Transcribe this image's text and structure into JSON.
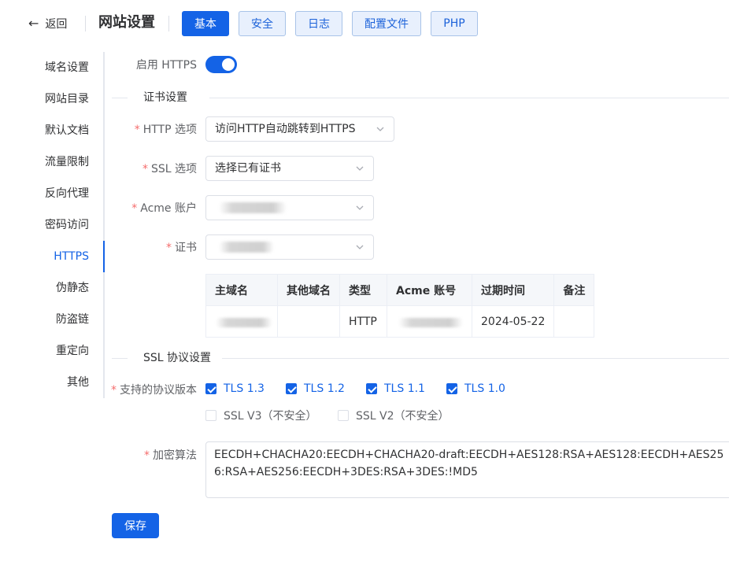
{
  "header": {
    "back_label": "返回",
    "title": "网站设置",
    "tabs": [
      "基本",
      "安全",
      "日志",
      "配置文件",
      "PHP"
    ]
  },
  "menu": {
    "items": [
      "域名设置",
      "网站目录",
      "默认文档",
      "流量限制",
      "反向代理",
      "密码访问",
      "HTTPS",
      "伪静态",
      "防盗链",
      "重定向",
      "其他"
    ],
    "active": "HTTPS"
  },
  "form": {
    "https_label": "启用 HTTPS",
    "https_enabled": true,
    "cert_section": "证书设置",
    "http_option_label": "HTTP 选项",
    "http_option_value": "访问HTTP自动跳转到HTTPS",
    "ssl_option_label": "SSL 选项",
    "ssl_option_value": "选择已有证书",
    "acme_label": "Acme 账户",
    "cert_label": "证书",
    "ssl_section": "SSL 协议设置",
    "protocols_label": "支持的协议版本",
    "protocols": [
      {
        "label": "TLS 1.3",
        "checked": true
      },
      {
        "label": "TLS 1.2",
        "checked": true
      },
      {
        "label": "TLS 1.1",
        "checked": true
      },
      {
        "label": "TLS 1.0",
        "checked": true
      },
      {
        "label": "SSL V3（不安全）",
        "checked": false
      },
      {
        "label": "SSL V2（不安全）",
        "checked": false
      }
    ],
    "cipher_label": "加密算法",
    "cipher_value": "EECDH+CHACHA20:EECDH+CHACHA20-draft:EECDH+AES128:RSA+AES128:EECDH+AES256:RSA+AES256:EECDH+3DES:RSA+3DES:!MD5",
    "save_label": "保存"
  },
  "cert_table": {
    "columns": [
      "主域名",
      "其他域名",
      "类型",
      "Acme 账号",
      "过期时间",
      "备注"
    ],
    "row": {
      "type": "HTTP",
      "expire": "2024-05-22",
      "other": "",
      "note": ""
    }
  },
  "colors": {
    "primary": "#1463e6",
    "required": "#f56c6c"
  }
}
